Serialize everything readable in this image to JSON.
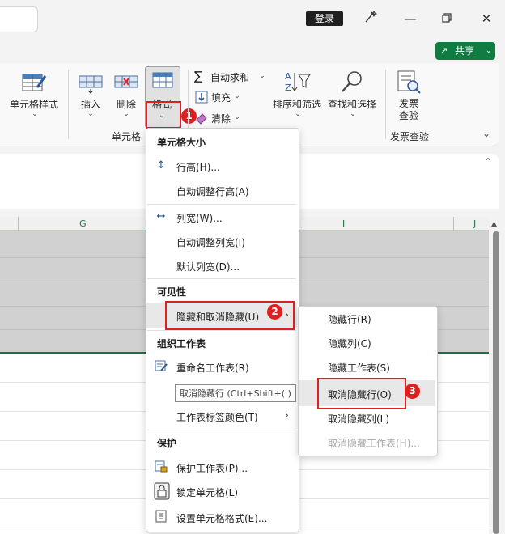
{
  "titlebar": {
    "login_label": "登录",
    "share_label": "共享"
  },
  "ribbon": {
    "cell_style_label": "单元格样式",
    "insert_label": "插入",
    "delete_label": "删除",
    "format_label": "格式",
    "cells_group_label": "单元格",
    "autosum_label": "自动求和",
    "fill_label": "填充",
    "clear_label": "清除",
    "sort_filter_label": "排序和筛选",
    "find_select_label": "查找和选择",
    "invoice_check_line1": "发票",
    "invoice_check_line2": "查验",
    "invoice_group_label": "发票查验"
  },
  "sheet": {
    "columns": [
      "G",
      "I",
      "J"
    ]
  },
  "badges": [
    "1",
    "2",
    "3"
  ],
  "format_menu": {
    "section_cell_size": "单元格大小",
    "row_height": "行高(H)...",
    "autofit_row": "自动调整行高(A)",
    "col_width": "列宽(W)...",
    "autofit_col": "自动调整列宽(I)",
    "default_width": "默认列宽(D)...",
    "section_visibility": "可见性",
    "hide_unhide": "隐藏和取消隐藏(U)",
    "section_organize": "组织工作表",
    "rename_sheet": "重命名工作表(R)",
    "tab_color": "工作表标签颜色(T)",
    "section_protect": "保护",
    "protect_sheet": "保护工作表(P)...",
    "lock_cell": "锁定单元格(L)",
    "format_cells": "设置单元格格式(E)..."
  },
  "submenu": {
    "hide_rows": "隐藏行(R)",
    "hide_cols": "隐藏列(C)",
    "hide_sheet": "隐藏工作表(S)",
    "unhide_rows": "取消隐藏行(O)",
    "unhide_cols": "取消隐藏列(L)",
    "unhide_sheet": "取消隐藏工作表(H)..."
  },
  "tooltip": "取消隐藏行 (Ctrl+Shift+( )",
  "colors": {
    "accent_green": "#107c41",
    "highlight_red": "#e02020"
  }
}
